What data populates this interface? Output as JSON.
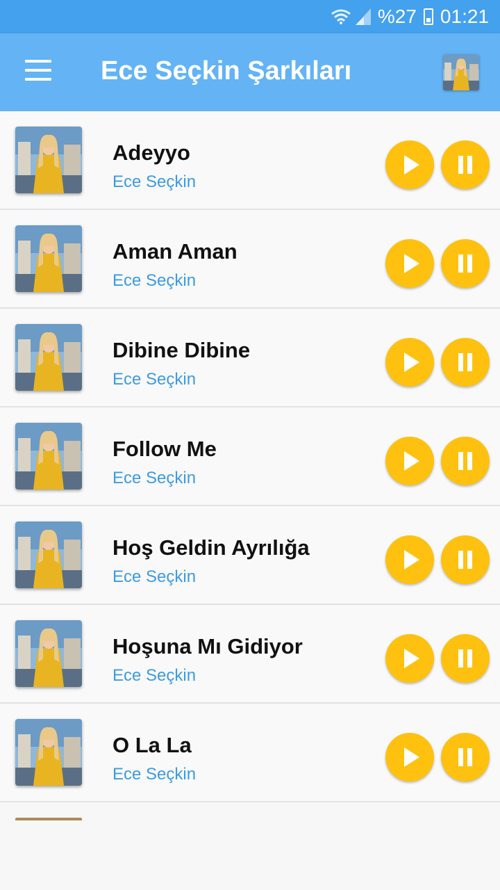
{
  "status_bar": {
    "battery_text": "%27",
    "time": "01:21",
    "icons": [
      "wifi-icon",
      "signal-icon",
      "battery-icon"
    ]
  },
  "app_bar": {
    "title": "Ece Seçkin Şarkıları",
    "menu_icon": "hamburger-menu-icon",
    "avatar_icon": "artist-avatar"
  },
  "songs": [
    {
      "title": "Adeyyo",
      "artist": "Ece Seçkin"
    },
    {
      "title": "Aman Aman",
      "artist": "Ece Seçkin"
    },
    {
      "title": "Dibine Dibine",
      "artist": "Ece Seçkin"
    },
    {
      "title": "Follow Me",
      "artist": "Ece Seçkin"
    },
    {
      "title": "Hoş Geldin Ayrılığa",
      "artist": "Ece Seçkin"
    },
    {
      "title": "Hoşuna Mı Gidiyor",
      "artist": "Ece Seçkin"
    },
    {
      "title": "O La La",
      "artist": "Ece Seçkin"
    }
  ],
  "colors": {
    "status_bar": "#43a1ee",
    "app_bar": "#63b3f5",
    "button": "#fec10f",
    "artist_text": "#3c9be0"
  }
}
